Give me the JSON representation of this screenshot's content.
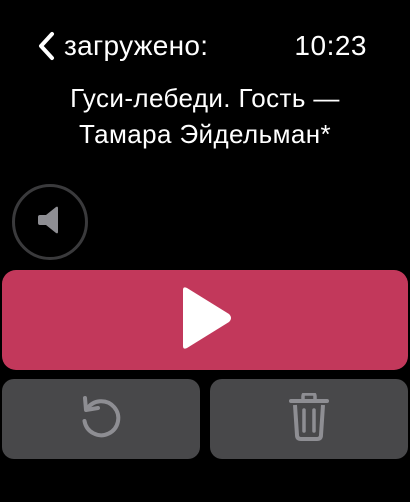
{
  "header": {
    "back_label": "загружено:",
    "time": "10:23"
  },
  "episode": {
    "title_line1": "Гуси-лебеди. Гость —",
    "title_line2": "Тамара Эйдельман*"
  },
  "controls": {
    "volume_icon": "speaker-icon",
    "play_icon": "play-icon",
    "restart_icon": "restart-icon",
    "delete_icon": "trash-icon"
  },
  "colors": {
    "accent": "#c2385b",
    "secondary_button": "#48484a",
    "icon_gray": "#8e8e93",
    "background": "#000000"
  }
}
